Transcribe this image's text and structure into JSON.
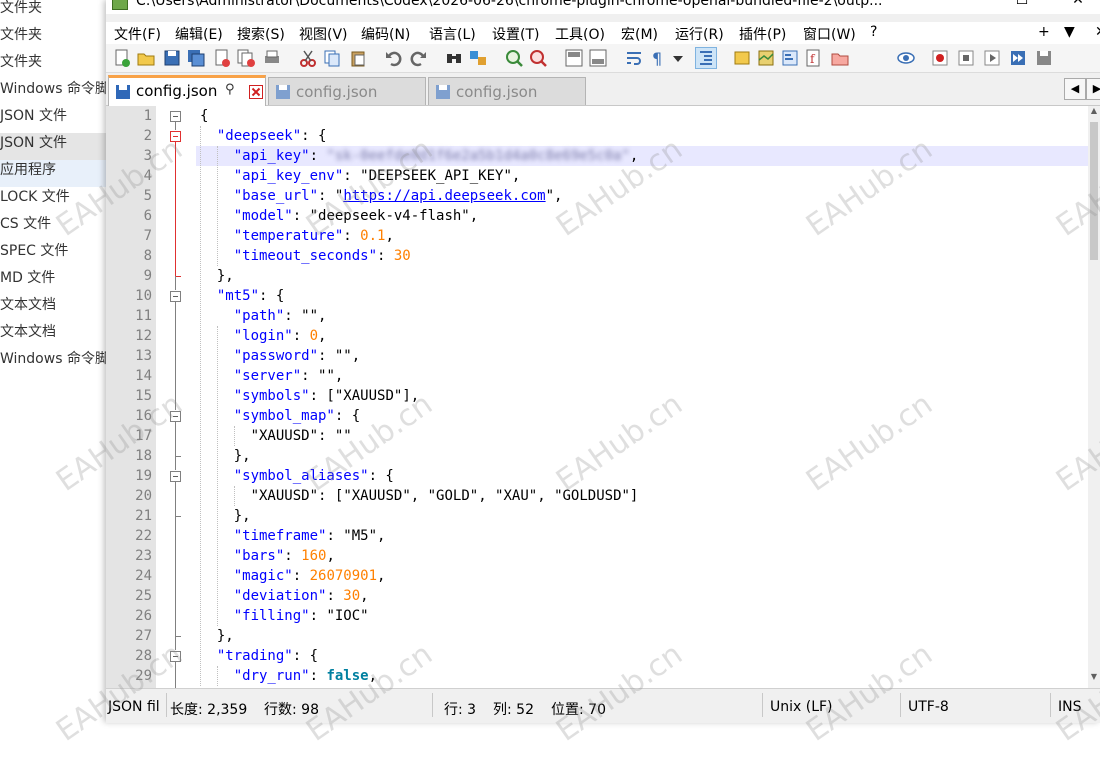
{
  "explorer": {
    "items": [
      {
        "label": "文件夹"
      },
      {
        "label": "文件夹"
      },
      {
        "label": "文件夹"
      },
      {
        "label": "Windows 命令脚本"
      },
      {
        "label": "JSON 文件"
      },
      {
        "label": "JSON 文件"
      },
      {
        "label": "应用程序"
      },
      {
        "label": "LOCK 文件"
      },
      {
        "label": "CS 文件"
      },
      {
        "label": "SPEC 文件"
      },
      {
        "label": "MD 文件"
      },
      {
        "label": "文本文档"
      },
      {
        "label": "文本文档"
      },
      {
        "label": "Windows 命令脚本"
      }
    ]
  },
  "window": {
    "title": "C:\\Users\\Administrator\\Documents\\Codex\\2026-06-26\\chrome-plugin-chrome-openai-bundled-file-2\\outp..."
  },
  "menu": {
    "items": [
      "文件(F)",
      "编辑(E)",
      "搜索(S)",
      "视图(V)",
      "编码(N)",
      "语言(L)",
      "设置(T)",
      "工具(O)",
      "宏(M)",
      "运行(R)",
      "插件(P)",
      "窗口(W)",
      "?"
    ],
    "plus": "+",
    "dropdown": "▼",
    "close": "✕"
  },
  "tabs": [
    {
      "label": "config.json",
      "active": true,
      "pin": "📌"
    },
    {
      "label": "config.json",
      "active": false
    },
    {
      "label": "config.json",
      "active": false
    }
  ],
  "editor": {
    "current_line": 3,
    "lines": [
      {
        "n": "1",
        "html": "{"
      },
      {
        "n": "2",
        "html": "  <span class=\"k\">\"deepseek\"</span>: {"
      },
      {
        "n": "3",
        "html": "    <span class=\"k\">\"api_key\"</span>: <span class=\"blur\">\"sk-0eefde0d1f6e2a5b1d4a0c8e69e5c0a\"</span>,"
      },
      {
        "n": "4",
        "html": "    <span class=\"k\">\"api_key_env\"</span>: <span class=\"s\">\"DEEPSEEK_API_KEY\"</span>,"
      },
      {
        "n": "5",
        "html": "    <span class=\"k\">\"base_url\"</span>: <span class=\"s\">\"<span class=\"url\">https://api.deepseek.com</span>\"</span>,"
      },
      {
        "n": "6",
        "html": "    <span class=\"k\">\"model\"</span>: <span class=\"s\">\"deepseek-v4-flash\"</span>,"
      },
      {
        "n": "7",
        "html": "    <span class=\"k\">\"temperature\"</span>: <span class=\"n\">0.1</span>,"
      },
      {
        "n": "8",
        "html": "    <span class=\"k\">\"timeout_seconds\"</span>: <span class=\"n\">30</span>"
      },
      {
        "n": "9",
        "html": "  },"
      },
      {
        "n": "10",
        "html": "  <span class=\"k\">\"mt5\"</span>: {"
      },
      {
        "n": "11",
        "html": "    <span class=\"k\">\"path\"</span>: <span class=\"s\">\"\"</span>,"
      },
      {
        "n": "12",
        "html": "    <span class=\"k\">\"login\"</span>: <span class=\"n\">0</span>,"
      },
      {
        "n": "13",
        "html": "    <span class=\"k\">\"password\"</span>: <span class=\"s\">\"\"</span>,"
      },
      {
        "n": "14",
        "html": "    <span class=\"k\">\"server\"</span>: <span class=\"s\">\"\"</span>,"
      },
      {
        "n": "15",
        "html": "    <span class=\"k\">\"symbols\"</span>: [<span class=\"s\">\"XAUUSD\"</span>],"
      },
      {
        "n": "16",
        "html": "    <span class=\"k\">\"symbol_map\"</span>: {"
      },
      {
        "n": "17",
        "html": "      <span class=\"s\">\"XAUUSD\"</span>: <span class=\"s\">\"\"</span>"
      },
      {
        "n": "18",
        "html": "    },"
      },
      {
        "n": "19",
        "html": "    <span class=\"k\">\"symbol_aliases\"</span>: {"
      },
      {
        "n": "20",
        "html": "      <span class=\"s\">\"XAUUSD\"</span>: [<span class=\"s\">\"XAUUSD\"</span>, <span class=\"s\">\"GOLD\"</span>, <span class=\"s\">\"XAU\"</span>, <span class=\"s\">\"GOLDUSD\"</span>]"
      },
      {
        "n": "21",
        "html": "    },"
      },
      {
        "n": "22",
        "html": "    <span class=\"k\">\"timeframe\"</span>: <span class=\"s\">\"M5\"</span>,"
      },
      {
        "n": "23",
        "html": "    <span class=\"k\">\"bars\"</span>: <span class=\"n\">160</span>,"
      },
      {
        "n": "24",
        "html": "    <span class=\"k\">\"magic\"</span>: <span class=\"n\">26070901</span>,"
      },
      {
        "n": "25",
        "html": "    <span class=\"k\">\"deviation\"</span>: <span class=\"n\">30</span>,"
      },
      {
        "n": "26",
        "html": "    <span class=\"k\">\"filling\"</span>: <span class=\"s\">\"IOC\"</span>"
      },
      {
        "n": "27",
        "html": "  },"
      },
      {
        "n": "28",
        "html": "  <span class=\"k\">\"trading\"</span>: {"
      },
      {
        "n": "29",
        "html": "    <span class=\"k\">\"dry_run\"</span>: <span class=\"b\">false</span>,"
      }
    ]
  },
  "status": {
    "file_type": "JSON fil",
    "length": "长度: 2,359",
    "lines": "行数: 98",
    "row": "行: 3",
    "col": "列: 52",
    "pos": "位置: 70",
    "eol": "Unix (LF)",
    "encoding": "UTF-8",
    "mode": "INS"
  },
  "watermark": {
    "text": "EAHub.cn"
  },
  "colors": {
    "keyword": "#0000ff",
    "number": "#ff8000",
    "boolean": "#0080a0",
    "tab_accent": "#f8a248",
    "current_line": "#e8e8ff"
  }
}
